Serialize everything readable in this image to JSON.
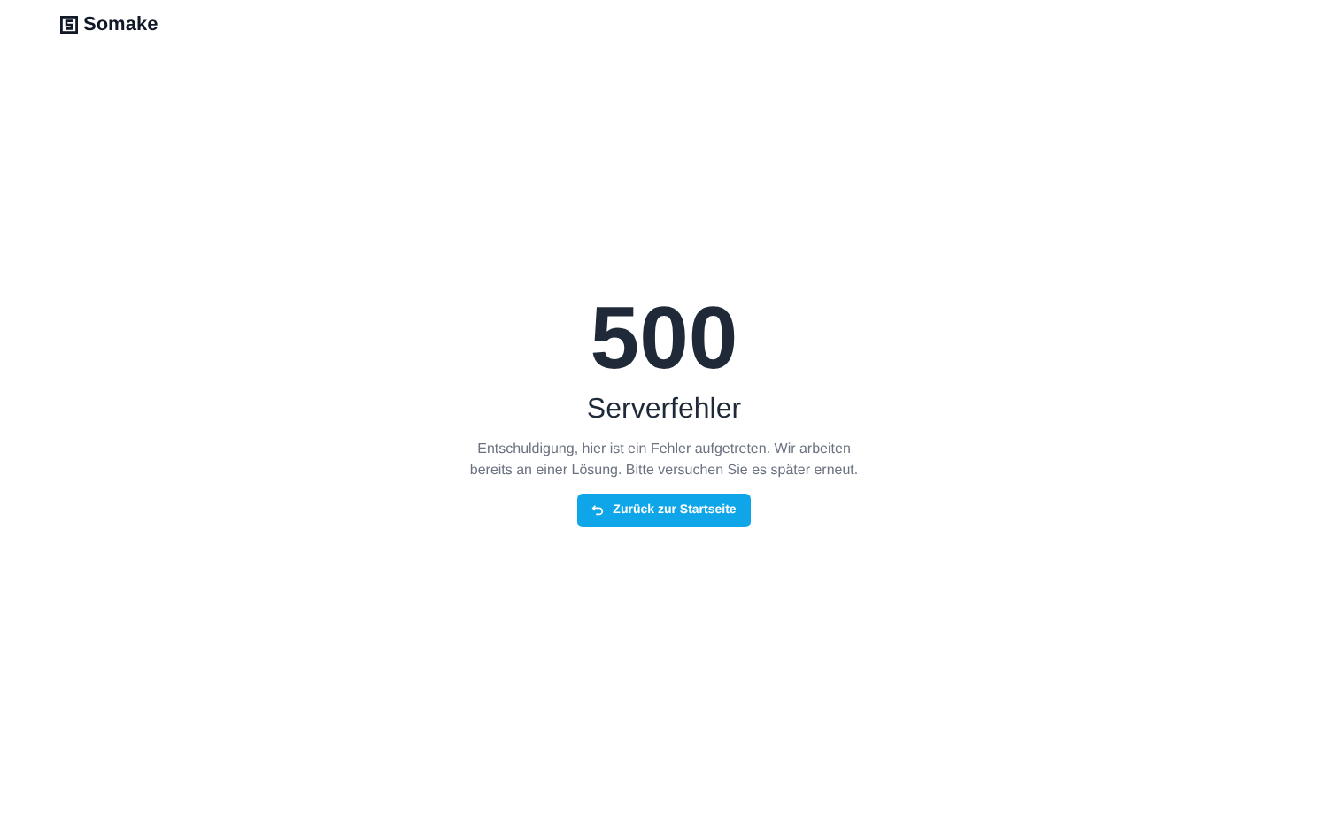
{
  "header": {
    "brand": "Somake"
  },
  "error": {
    "code": "500",
    "title": "Serverfehler",
    "message": "Entschuldigung, hier ist ein Fehler aufgetreten. Wir arbeiten bereits an einer Lösung. Bitte versuchen Sie es später erneut.",
    "button": "Zurück zur Startseite"
  }
}
